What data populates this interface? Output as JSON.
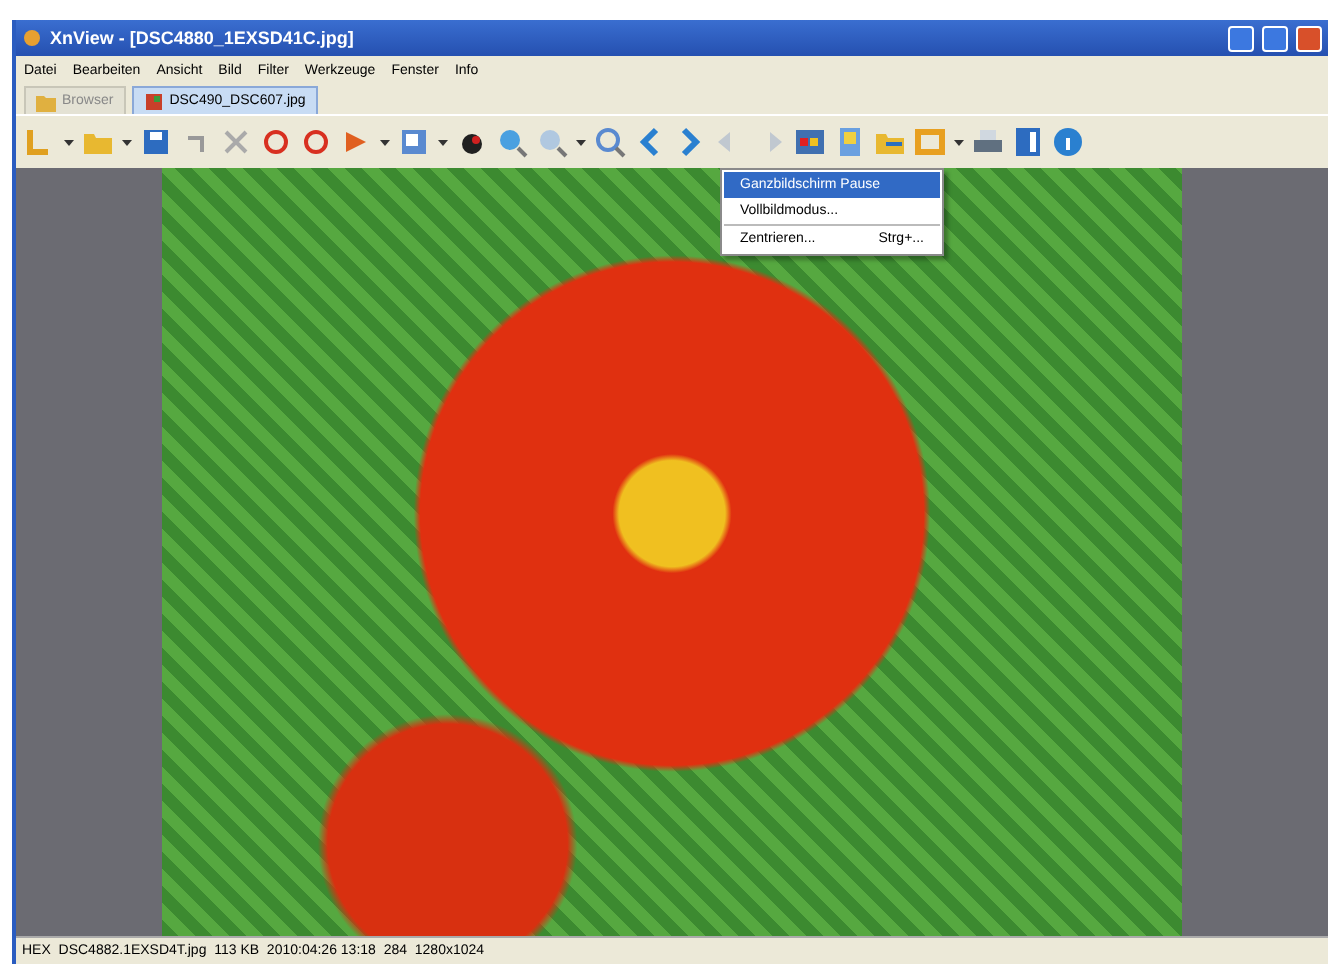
{
  "window": {
    "title": "XnView - [DSC4880_1EXSD41C.jpg]"
  },
  "menu": [
    "Datei",
    "Bearbeiten",
    "Ansicht",
    "Bild",
    "Filter",
    "Werkzeuge",
    "Fenster",
    "Info"
  ],
  "tabs": [
    {
      "label": "Browser",
      "selected": false
    },
    {
      "label": "DSC490_DSC607.jpg",
      "selected": true
    }
  ],
  "dropdown": {
    "items": [
      {
        "label": "Ganzbildschirm Pause",
        "selected": true
      },
      {
        "label": "Vollbildmodus...",
        "selected": false
      },
      {
        "label": "Zentrieren...",
        "shortcut": "Strg+...",
        "selected": false
      }
    ]
  },
  "status_bar": "HEX  DSC4882.1EXSD4T.jpg  113 KB  2010:04:26 13:18  284  1280x1024"
}
